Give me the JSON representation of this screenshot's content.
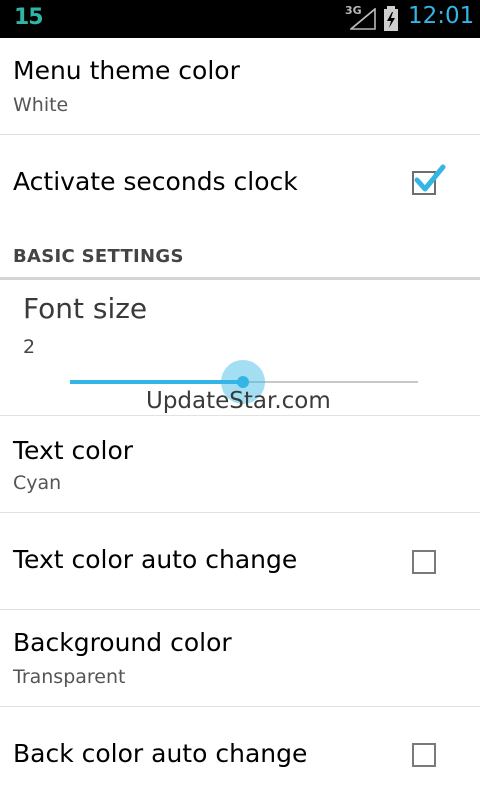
{
  "status_bar": {
    "app_badge": "15",
    "network": "3G",
    "time": "12:01",
    "icons": [
      "signal-icon",
      "battery-charging-icon"
    ]
  },
  "preferences": {
    "menu_theme_color": {
      "title": "Menu theme color",
      "summary": "White"
    },
    "activate_seconds_clock": {
      "title": "Activate seconds clock",
      "checked": true
    },
    "section_basic": {
      "label": "BASIC SETTINGS"
    },
    "font_size": {
      "title": "Font size",
      "value": "2",
      "slider_fraction": 0.5,
      "watermark": "UpdateStar.com"
    },
    "text_color": {
      "title": "Text color",
      "summary": "Cyan"
    },
    "text_color_auto_change": {
      "title": "Text color auto change",
      "checked": false
    },
    "background_color": {
      "title": "Background color",
      "summary": "Transparent"
    },
    "back_color_auto_change": {
      "title": "Back color auto change",
      "checked": false
    }
  },
  "colors": {
    "accent": "#33b5e5",
    "badge": "#2fb5a6",
    "status_bar_bg": "#000000"
  }
}
